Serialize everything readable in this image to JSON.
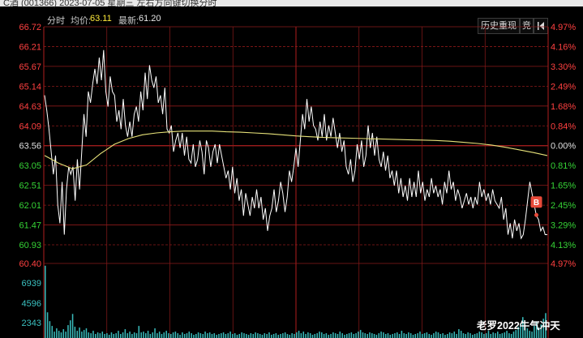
{
  "title_bar": {
    "text": "C酒 (001366) 2023-07-05 星期三 左右方向键切换分时"
  },
  "header": {
    "period_label": "分时",
    "avg_label": "均价:",
    "avg_value": "63.11",
    "latest_label": "最新:",
    "latest_value": "61.20",
    "history_button": "历史重现",
    "auction_button": "竞",
    "collapse_icon": "collapse-left-icon"
  },
  "price_axis_left": [
    "66.72",
    "66.21",
    "65.67",
    "65.14",
    "64.63",
    "64.09",
    "63.56",
    "63.05",
    "62.51",
    "62.01",
    "61.47",
    "60.93"
  ],
  "price_axis_right": [
    "4.97%",
    "4.16%",
    "3.30%",
    "2.49%",
    "1.68%",
    "0.84%",
    "0.00%",
    "0.81%",
    "1.65%",
    "2.45%",
    "3.29%",
    "4.13%"
  ],
  "volume_axis_left": [
    "60.40",
    "6939",
    "4596",
    "2343"
  ],
  "volume_axis_right": [
    "4.97%"
  ],
  "marker": {
    "label": "B"
  },
  "watermark": "老罗2022牛气冲天",
  "colors": {
    "background": "#000000",
    "grid": "#8b1a1a",
    "axis_red": "#ff4040",
    "axis_green": "#36d436",
    "price_line": "#ffffff",
    "avg_line": "#e8e37a",
    "volume_bar": "#38b8b8",
    "marker": "#e84a3a"
  },
  "chart_data": {
    "type": "line",
    "ylim": [
      60.93,
      66.72
    ],
    "reference_price": 63.56,
    "series": [
      {
        "values": [
          64.9,
          64.5,
          64.0,
          63.4,
          62.8,
          63.3,
          62.0,
          61.5,
          62.6,
          61.2,
          62.4,
          63.0,
          62.8,
          63.0,
          62.1,
          63.2,
          62.4,
          63.4,
          64.4,
          63.8,
          65.0,
          64.7,
          65.2,
          65.6,
          65.2,
          65.9,
          65.3,
          66.1,
          65.0,
          64.6,
          65.4,
          65.0,
          64.9,
          64.2,
          64.5,
          64.0,
          64.8,
          64.1,
          63.8,
          64.2,
          63.8,
          64.4,
          64.6,
          64.2,
          65.0,
          64.5,
          65.5,
          64.8,
          65.7,
          65.3,
          65.1,
          65.4,
          64.7,
          64.9,
          64.4,
          65.1,
          64.0,
          63.9,
          64.1,
          63.4,
          63.7,
          63.9,
          63.5,
          63.9,
          63.3,
          63.8,
          63.2,
          63.1,
          63.6,
          63.0,
          63.2,
          63.7,
          63.4,
          62.8,
          63.7,
          63.5,
          63.0,
          63.4,
          63.6,
          63.1,
          63.6,
          63.3,
          63.0,
          62.7,
          62.9,
          62.4,
          63.0,
          62.3,
          62.7,
          62.1,
          62.4,
          61.7,
          62.3,
          62.0,
          61.7,
          62.2,
          61.9,
          62.4,
          61.9,
          62.2,
          61.6,
          61.9,
          61.3,
          61.7,
          61.9,
          62.4,
          61.8,
          62.1,
          62.6,
          62.3,
          61.8,
          62.2,
          62.9,
          62.6,
          63.0,
          63.5,
          63.0,
          63.7,
          64.4,
          64.0,
          64.8,
          64.2,
          64.6,
          64.1,
          64.0,
          63.7,
          64.2,
          63.8,
          64.4,
          63.7,
          64.1,
          63.8,
          64.3,
          63.9,
          63.5,
          63.9,
          63.4,
          63.7,
          63.0,
          62.8,
          63.2,
          62.6,
          62.9,
          63.6,
          63.2,
          63.7,
          63.0,
          63.3,
          64.1,
          63.5,
          63.9,
          63.3,
          63.8,
          63.2,
          63.0,
          63.4,
          62.9,
          63.3,
          62.7,
          62.9,
          62.5,
          62.9,
          62.3,
          62.7,
          62.2,
          62.5,
          62.1,
          62.7,
          62.2,
          62.6,
          62.2,
          62.9,
          62.3,
          62.6,
          62.1,
          62.4,
          62.2,
          62.7,
          62.3,
          62.5,
          62.2,
          62.4,
          62.0,
          62.6,
          62.3,
          62.9,
          62.4,
          62.6,
          62.1,
          62.4,
          62.2,
          61.9,
          62.1,
          62.3,
          62.0,
          62.2,
          61.9,
          62.2,
          62.0,
          62.6,
          62.2,
          62.4,
          62.1,
          62.3,
          62.0,
          62.4,
          62.1,
          62.0,
          61.9,
          62.2,
          61.6,
          61.9,
          61.2,
          61.5,
          61.1,
          61.6,
          61.3,
          61.5,
          61.1,
          61.2,
          61.6,
          62.1,
          62.6,
          62.3,
          62.0,
          61.7,
          61.6,
          61.3,
          61.4,
          61.2,
          61.2
        ],
        "color": "#ffffff"
      },
      {
        "values": [
          63.3,
          63.1,
          62.95,
          63.05,
          63.35,
          63.6,
          63.75,
          63.85,
          63.9,
          63.93,
          63.95,
          63.95,
          63.95,
          63.93,
          63.92,
          63.9,
          63.88,
          63.85,
          63.82,
          63.8,
          63.78,
          63.77,
          63.76,
          63.75,
          63.74,
          63.73,
          63.72,
          63.71,
          63.7,
          63.68,
          63.65,
          63.62,
          63.58,
          63.52,
          63.45,
          63.38,
          63.3
        ],
        "color": "#e8e37a"
      }
    ],
    "volume": {
      "ylim": [
        0,
        9282
      ],
      "values": [
        9000,
        3200,
        2100,
        1500,
        800,
        1200,
        900,
        700,
        1100,
        800,
        1600,
        2200,
        3000,
        1400,
        900,
        1300,
        800,
        1000,
        1200,
        700,
        600,
        900,
        500,
        700,
        600,
        800,
        500,
        600,
        400,
        700,
        500,
        600,
        900,
        500,
        700,
        1100,
        600,
        800,
        500,
        700,
        600,
        1500,
        700,
        800,
        600,
        900,
        500,
        700,
        1200,
        600,
        800,
        500,
        700,
        900,
        600,
        500,
        700,
        800,
        600,
        400,
        700,
        500,
        600,
        800,
        600,
        400,
        500,
        700,
        600,
        500,
        800,
        600,
        700,
        500,
        600,
        400,
        500,
        600,
        700,
        500,
        600,
        800,
        500,
        600,
        400,
        500,
        700,
        600,
        500,
        400,
        600,
        500,
        700,
        600,
        500,
        400,
        600,
        500,
        700,
        400,
        500,
        600,
        400,
        500,
        600,
        700,
        500,
        400,
        600,
        500,
        700,
        900,
        600,
        800,
        500,
        700,
        600,
        400,
        500,
        600,
        800,
        700,
        500,
        600,
        400,
        500,
        700,
        600,
        500,
        800,
        600,
        400,
        500,
        600,
        700,
        500,
        600,
        800,
        1000,
        700,
        600,
        500,
        700,
        600,
        500,
        400,
        600,
        800,
        700,
        500,
        600,
        400,
        500,
        600,
        700,
        500,
        900,
        600,
        500,
        700,
        600,
        400,
        500,
        600,
        800,
        500,
        600,
        700,
        500,
        400,
        600,
        800,
        700,
        500,
        600,
        400,
        500,
        700,
        600,
        800,
        500,
        1100,
        900,
        600,
        500,
        700,
        600,
        400,
        500,
        600,
        800,
        700,
        500,
        600,
        900,
        500,
        700,
        600,
        800,
        500,
        600,
        700,
        900,
        600,
        500,
        800,
        1000,
        1400,
        1800,
        2600,
        1600,
        1200,
        900,
        800,
        1500,
        2000,
        1300,
        1700,
        2400,
        3100
      ]
    }
  }
}
